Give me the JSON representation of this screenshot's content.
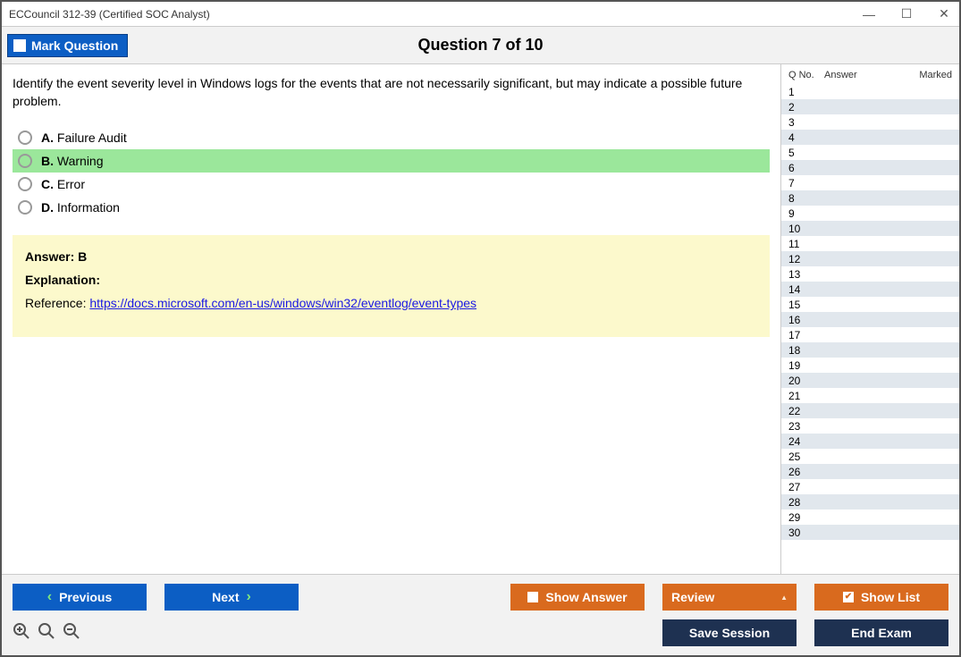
{
  "window": {
    "title": "ECCouncil 312-39 (Certified SOC Analyst)"
  },
  "header": {
    "mark_label": "Mark Question",
    "counter": "Question 7 of 10"
  },
  "question": {
    "text": "Identify the event severity level in Windows logs for the events that are not necessarily significant, but may indicate a possible future problem.",
    "options": [
      {
        "letter": "A.",
        "text": "Failure Audit",
        "correct": false
      },
      {
        "letter": "B.",
        "text": "Warning",
        "correct": true
      },
      {
        "letter": "C.",
        "text": "Error",
        "correct": false
      },
      {
        "letter": "D.",
        "text": "Information",
        "correct": false
      }
    ]
  },
  "answer": {
    "line": "Answer: B",
    "exp_label": "Explanation:",
    "ref_prefix": "Reference: ",
    "ref_url": "https://docs.microsoft.com/en-us/windows/win32/eventlog/event-types"
  },
  "list": {
    "headers": {
      "qno": "Q No.",
      "answer": "Answer",
      "marked": "Marked"
    },
    "count": 30
  },
  "footer": {
    "previous": "Previous",
    "next": "Next",
    "show_answer": "Show Answer",
    "review": "Review",
    "show_list": "Show List",
    "save_session": "Save Session",
    "end_exam": "End Exam"
  }
}
